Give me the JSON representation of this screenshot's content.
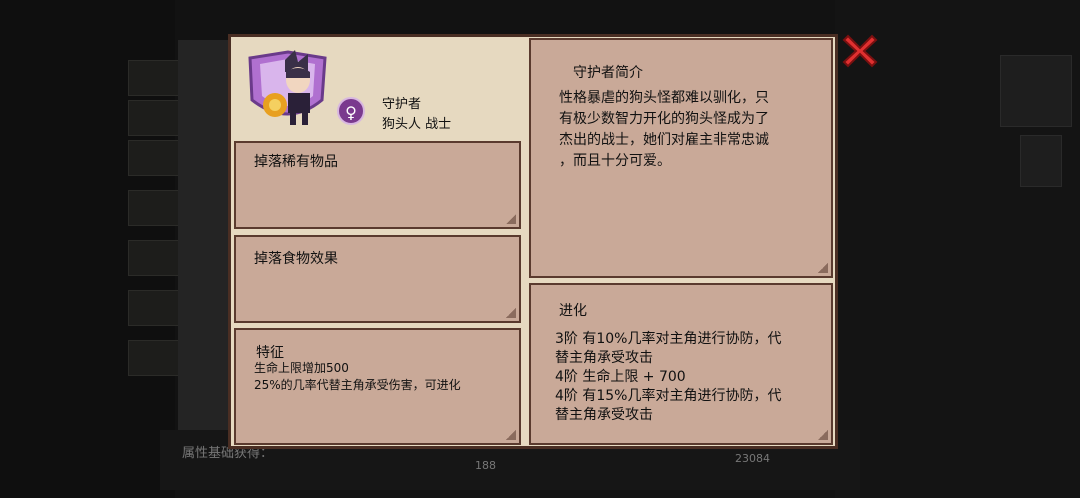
{
  "dialog": {
    "guardian_label": "守护者",
    "guardian_type": "狗头人 战士",
    "badge_symbol": "♀",
    "drops_rare_title": "掉落稀有物品",
    "drops_food_title": "掉落食物效果",
    "traits": {
      "title": "特征",
      "lines": [
        "生命上限增加500",
        "25%的几率代替主角承受伤害，可进化"
      ]
    },
    "intro": {
      "title": "守护者简介",
      "lines": [
        "性格暴虐的狗头怪都难以驯化，只",
        "有极少数智力开化的狗头怪成为了",
        "杰出的战士，她们对雇主非常忠诚",
        "，而且十分可爱。"
      ]
    },
    "evolution": {
      "title": "进化",
      "lines": [
        "3阶 有10%几率对主角进行协防，代",
        "替主角承受攻击",
        "4阶 生命上限 + 700",
        "4阶 有15%几率对主角进行协防，代",
        "替主角承受攻击"
      ]
    }
  },
  "background": {
    "bottom_text": "属性基础获得：",
    "bottom_num": "188",
    "right_num": "23084"
  },
  "colors": {
    "dialog_bg": "#e6d9c0",
    "panel_bg": "#c9a998",
    "border": "#4a2e23",
    "close": "#e03030",
    "shield": "#b070d0"
  }
}
